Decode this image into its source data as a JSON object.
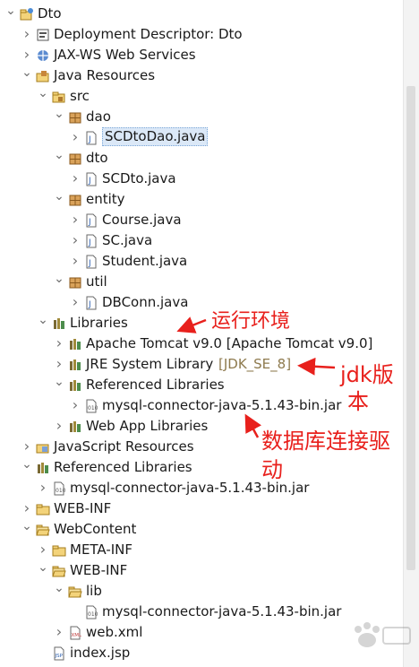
{
  "tree": [
    {
      "indent": 0,
      "open": true,
      "icon": "project-icon",
      "label": "Dto"
    },
    {
      "indent": 1,
      "open": false,
      "icon": "descriptor-icon",
      "label": "Deployment Descriptor: Dto"
    },
    {
      "indent": 1,
      "open": false,
      "icon": "webservice-icon",
      "label": "JAX-WS Web Services"
    },
    {
      "indent": 1,
      "open": true,
      "icon": "java-resources-icon",
      "label": "Java Resources"
    },
    {
      "indent": 2,
      "open": true,
      "icon": "source-folder-icon",
      "label": "src"
    },
    {
      "indent": 3,
      "open": true,
      "icon": "package-icon",
      "label": "dao"
    },
    {
      "indent": 4,
      "open": false,
      "icon": "java-file-icon",
      "label": "SCDtoDao.java",
      "selected": true
    },
    {
      "indent": 3,
      "open": true,
      "icon": "package-icon",
      "label": "dto"
    },
    {
      "indent": 4,
      "open": false,
      "icon": "java-file-icon",
      "label": "SCDto.java"
    },
    {
      "indent": 3,
      "open": true,
      "icon": "package-icon",
      "label": "entity"
    },
    {
      "indent": 4,
      "open": false,
      "icon": "java-file-icon",
      "label": "Course.java"
    },
    {
      "indent": 4,
      "open": false,
      "icon": "java-file-icon",
      "label": "SC.java"
    },
    {
      "indent": 4,
      "open": false,
      "icon": "java-file-icon",
      "label": "Student.java"
    },
    {
      "indent": 3,
      "open": true,
      "icon": "package-icon",
      "label": "util"
    },
    {
      "indent": 4,
      "open": false,
      "icon": "java-file-icon",
      "label": "DBConn.java"
    },
    {
      "indent": 2,
      "open": true,
      "icon": "library-icon",
      "label": "Libraries"
    },
    {
      "indent": 3,
      "open": false,
      "icon": "library-icon",
      "label": "Apache Tomcat v9.0 [Apache Tomcat v9.0]"
    },
    {
      "indent": 3,
      "open": false,
      "icon": "library-icon",
      "label": "JRE System Library",
      "decoration": "[JDK_SE_8]"
    },
    {
      "indent": 3,
      "open": true,
      "icon": "library-icon",
      "label": "Referenced Libraries"
    },
    {
      "indent": 4,
      "open": false,
      "icon": "jar-icon",
      "label": "mysql-connector-java-5.1.43-bin.jar"
    },
    {
      "indent": 3,
      "open": false,
      "icon": "library-icon",
      "label": "Web App Libraries"
    },
    {
      "indent": 1,
      "open": false,
      "icon": "js-resources-icon",
      "label": "JavaScript Resources"
    },
    {
      "indent": 1,
      "open": true,
      "icon": "library-icon",
      "label": "Referenced Libraries"
    },
    {
      "indent": 2,
      "open": false,
      "icon": "jar-icon",
      "label": "mysql-connector-java-5.1.43-bin.jar"
    },
    {
      "indent": 1,
      "open": false,
      "icon": "folder-icon",
      "label": "WEB-INF"
    },
    {
      "indent": 1,
      "open": true,
      "icon": "folder-open-icon",
      "label": "WebContent"
    },
    {
      "indent": 2,
      "open": false,
      "icon": "folder-icon",
      "label": "META-INF"
    },
    {
      "indent": 2,
      "open": true,
      "icon": "folder-open-icon",
      "label": "WEB-INF"
    },
    {
      "indent": 3,
      "open": true,
      "icon": "folder-open-icon",
      "label": "lib"
    },
    {
      "indent": 4,
      "open": false,
      "icon": "jar-icon",
      "label": "mysql-connector-java-5.1.43-bin.jar",
      "leaf": true
    },
    {
      "indent": 3,
      "open": false,
      "icon": "xml-file-icon",
      "label": "web.xml"
    },
    {
      "indent": 2,
      "open": false,
      "icon": "jsp-file-icon",
      "label": "index.jsp",
      "leaf": true
    }
  ],
  "annotations": {
    "runtime_env": "运行环境",
    "jdk_version_1": "jdk版",
    "jdk_version_2": "本",
    "db_driver_1": "数据库连接驱",
    "db_driver_2": "动"
  },
  "colors": {
    "annotation": "#e8201c",
    "selection": "#dbe8f7",
    "decoration": "#8e7a4e",
    "folder": "#e8c24a",
    "package": "#b07a2e",
    "library": "#6b5a2a"
  }
}
